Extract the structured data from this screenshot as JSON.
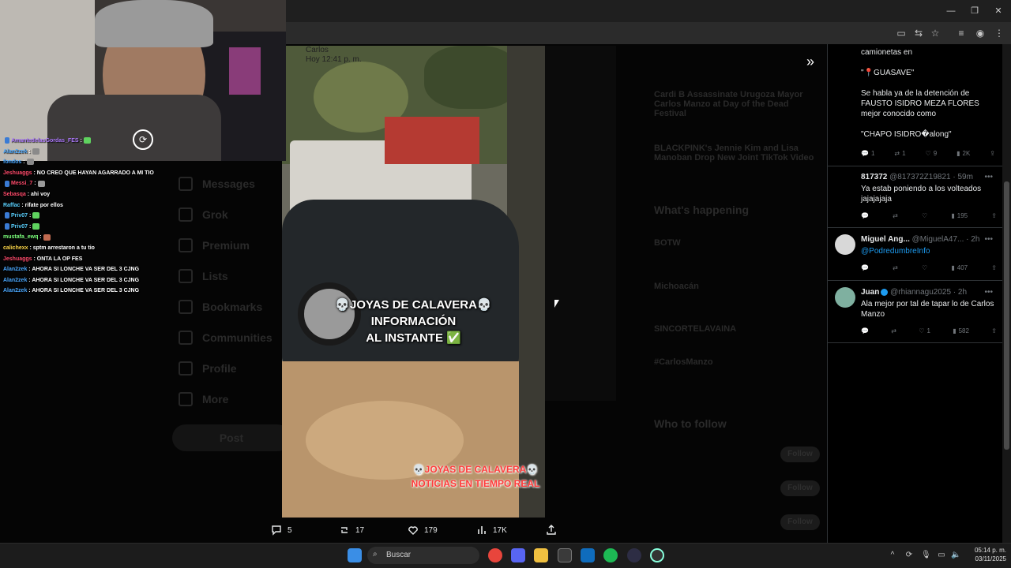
{
  "chat": [
    {
      "user": "AmantedelasGordas_FES",
      "color": "#b07cff",
      "text": ":",
      "emote": "#5fd35f",
      "badges": true
    },
    {
      "user": "Alan2zek",
      "color": "#4aa8ff",
      "text": ":",
      "emote": "#8a8a8a"
    },
    {
      "user": "fondos",
      "color": "#4aa8ff",
      "text": ":",
      "emote": "#8a8a8a"
    },
    {
      "user": "Jeshuaggs",
      "color": "#ff4b6b",
      "text": ": NO CREO QUE HAYAN AGARRADO A MI TIO"
    },
    {
      "user": "Messi_7",
      "color": "#ff4b6b",
      "text": ":",
      "emote": "#9a9a9a",
      "badges": true
    },
    {
      "user": "Sebasqa",
      "color": "#ff4b6b",
      "text": ": ahi voy"
    },
    {
      "user": "Raffac",
      "color": "#5ad1ff",
      "text": ": rifate por ellos"
    },
    {
      "user": "Priv07",
      "color": "#5ad1ff",
      "text": ":",
      "emote": "#5fd35f",
      "badges": true
    },
    {
      "user": "Priv07",
      "color": "#5ad1ff",
      "text": ":",
      "emote": "#5fd35f",
      "badges": true
    },
    {
      "user": "mustafa_ewq",
      "color": "#7cff7c",
      "text": ":",
      "emote": "#c06a50"
    },
    {
      "user": "calichexx",
      "color": "#ffd84a",
      "text": ": sptm arrestaron a tu tio"
    },
    {
      "user": "Jeshuaggs",
      "color": "#ff4b6b",
      "text": ": ONTA LA OP FES"
    },
    {
      "user": "Alan2zek",
      "color": "#4aa8ff",
      "text": ": AHORA SI LONCHE VA SER DEL 3 CJNG"
    },
    {
      "user": "Alan2zek",
      "color": "#4aa8ff",
      "text": ": AHORA SI LONCHE VA SER DEL 3 CJNG"
    },
    {
      "user": "Alan2zek",
      "color": "#4aa8ff",
      "text": ": AHORA SI LONCHE VA SER DEL 3 CJNG"
    }
  ],
  "media": {
    "header": "Carlos\nHoy 12:41 p. m.",
    "caption1": "💀JOYAS DE CALAVERA💀\nINFORMACIÓN\nAL INSTANTE ✅",
    "caption2": "💀JOYAS DE CALAVERA💀\nNOTICIAS EN TIEMPO REAL"
  },
  "post_actions": {
    "replies": "5",
    "reposts": "17",
    "likes": "179",
    "views": "17K"
  },
  "right_panel": {
    "main_tweet": {
      "lines": [
        "camionetas en",
        "",
        "\"📍GUASAVE\"",
        "",
        "Se habla ya de la detención de",
        "FAUSTO ISIDRO MEZA FLORES",
        "mejor conocido como",
        "",
        "\"CHAPO ISIDRO�along\""
      ],
      "replies": "1",
      "reposts": "1",
      "likes": "9",
      "views": "2K"
    },
    "replies": [
      {
        "name": "817372",
        "handle": "@817372Z19821 · 59m",
        "body": "Ya estab poniendo a los volteados jajajajaja",
        "replies": "",
        "reposts": "",
        "likes": "",
        "views": "195",
        "avatar": "#000000"
      },
      {
        "name": "Miguel Ang...",
        "handle": "@MiguelA47... · 2h",
        "body": "@PodredumbreInfo",
        "link": true,
        "replies": "",
        "reposts": "",
        "likes": "",
        "views": "407",
        "avatar": "#cfcfcf"
      },
      {
        "name": "Juan",
        "handle": "@rhiannagu2025 · 2h",
        "body": "Ala mejor por tal de tapar lo de Carlos Manzo",
        "verified": true,
        "replies": "",
        "reposts": "",
        "likes": "1",
        "views": "582",
        "avatar": "#7fb0a0"
      }
    ]
  },
  "taskbar": {
    "search_placeholder": "Buscar",
    "time": "05:14 p. m.",
    "date": "03/11/2025"
  },
  "background": {
    "nav": [
      "Messages",
      "Grok",
      "Premium",
      "Lists",
      "Bookmarks",
      "Communities",
      "Profile",
      "More"
    ],
    "post_label": "Post",
    "trends": [
      "Cardi B Assassinate Urugoza Mayor Carlos Manzo at Day of the Dead Festival",
      "BLACKPINK's Jennie Kim and Lisa Manoban Drop New Joint TikTok Video"
    ],
    "happening": "What's happening",
    "happening_items": [
      "BOTW",
      "Michoacán",
      "SINCORTELAVAINA",
      "#CarlosManzo"
    ],
    "who_to_follow": "Who to follow",
    "follow": "Follow"
  }
}
